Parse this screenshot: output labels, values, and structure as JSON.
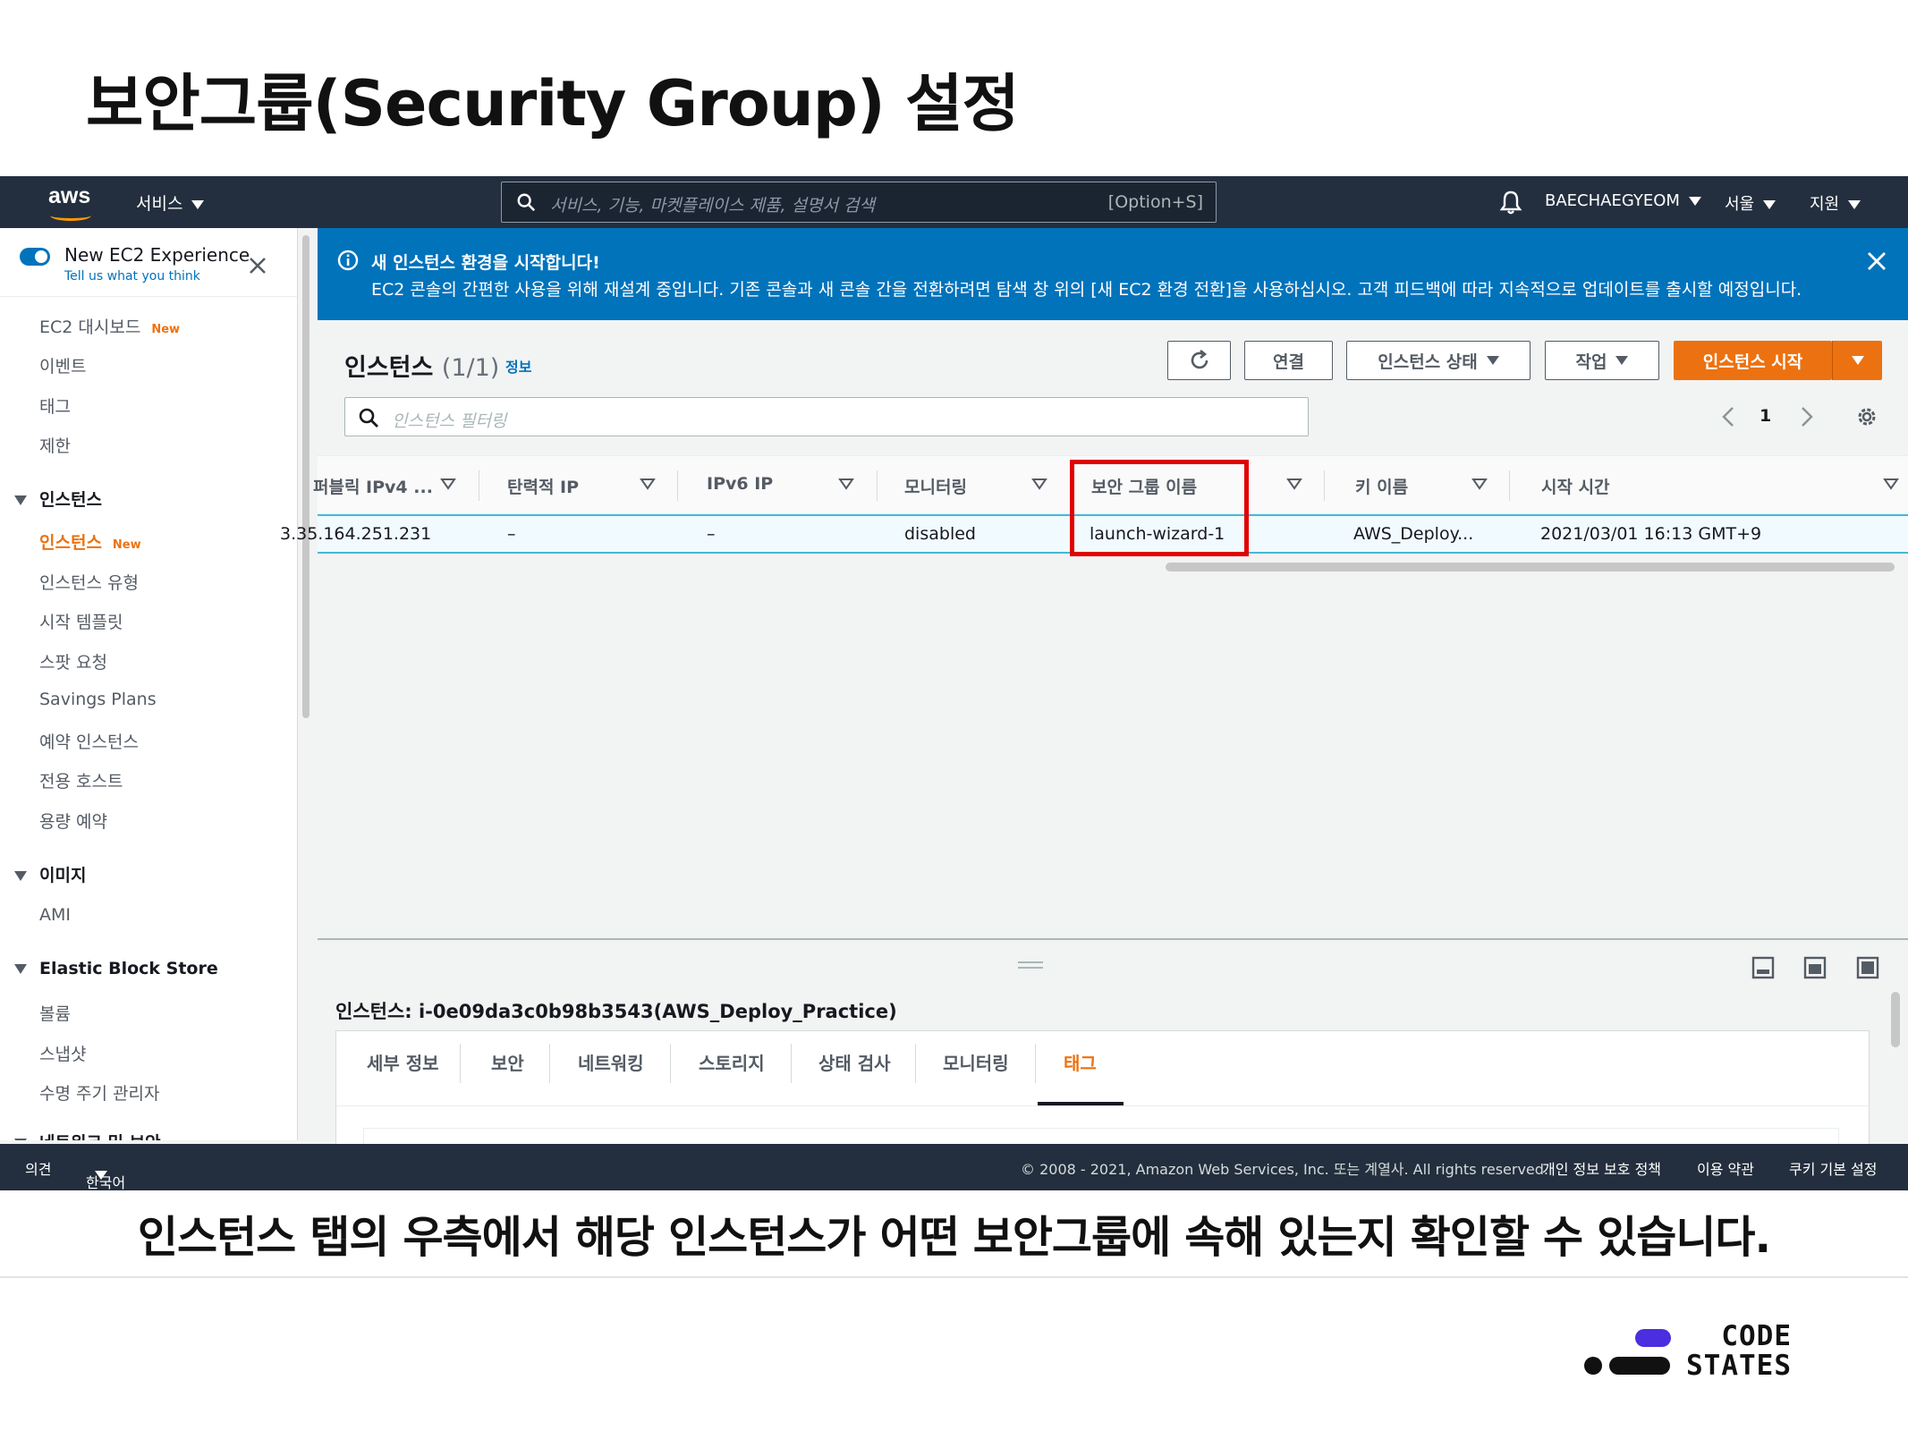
{
  "slide": {
    "title": "보안그룹(Security Group) 설정",
    "caption": "인스턴스 탭의 우측에서 해당 인스턴스가 어떤 보안그룹에 속해 있는지 확인할 수 있습니다.",
    "brand_line1": "CODE",
    "brand_line2": "STATES",
    "brand_color": "#4a2ee0"
  },
  "topnav": {
    "logo_text": "aws",
    "services": "서비스",
    "search_placeholder": "서비스, 기능, 마켓플레이스 제품, 설명서 검색",
    "search_shortcut": "[Option+S]",
    "user": "BAECHAEGYEOM",
    "region": "서울",
    "support": "지원",
    "bg_color": "#232f3e",
    "accent_color": "#ff9900"
  },
  "sidebar": {
    "experience_title": "New EC2 Experience",
    "experience_sub": "Tell us what you think",
    "new_badge": "New",
    "items_top": [
      "EC2 대시보드",
      "이벤트",
      "태그",
      "제한"
    ],
    "section_instances": "인스턴스",
    "instances_items": [
      "인스턴스",
      "인스턴스 유형",
      "시작 템플릿",
      "스팟 요청",
      "Savings Plans",
      "예약 인스턴스",
      "전용 호스트",
      "용량 예약"
    ],
    "section_images": "이미지",
    "images_items": [
      "AMI"
    ],
    "section_ebs": "Elastic Block Store",
    "ebs_items": [
      "볼륨",
      "스냅샷",
      "수명 주기 관리자"
    ],
    "section_network": "네트워크 및 보안"
  },
  "banner": {
    "title": "새 인스턴스 환경을 시작합니다!",
    "text": "EC2 콘솔의 간편한 사용을 위해 재설계 중입니다. 기존 콘솔과 새 콘솔 간을 전환하려면 탐색 창 위의 [새 EC2 환경 전환]을 사용하십시오. 고객 피드백에 따라 지속적으로 업데이트를 출시할 예정입니다.",
    "color": "#0073bb"
  },
  "instances": {
    "title": "인스턴스",
    "count": "(1/1)",
    "info_link": "정보",
    "btn_connect": "연결",
    "btn_state": "인스턴스 상태",
    "btn_actions": "작업",
    "btn_launch": "인스턴스 시작",
    "filter_placeholder": "인스턴스 필터링",
    "page": "1",
    "primary_color": "#ec7211"
  },
  "table": {
    "columns": [
      "퍼블릭 IPv4 ...",
      "탄력적 IP",
      "IPv6 IP",
      "모니터링",
      "보안 그룹 이름",
      "키 이름",
      "시작 시간"
    ],
    "rows": [
      [
        "3.35.164.251.231",
        "–",
        "–",
        "disabled",
        "launch-wizard-1",
        "AWS_Deploy...",
        "2021/03/01 16:13 GMT+9"
      ]
    ],
    "highlight_color": "#e00000"
  },
  "details": {
    "title": "인스턴스: i-0e09da3c0b98b3543(AWS_Deploy_Practice)",
    "tabs": [
      "세부 정보",
      "보안",
      "네트워킹",
      "스토리지",
      "상태 검사",
      "모니터링",
      "태그"
    ],
    "active_tab": "태그"
  },
  "footer": {
    "feedback": "의견",
    "language": "한국어",
    "copyright": "© 2008 - 2021, Amazon Web Services, Inc. 또는 계열사. All rights reserved.",
    "privacy": "개인 정보 보호 정책",
    "terms": "이용 약관",
    "cookies": "쿠키 기본 설정"
  }
}
